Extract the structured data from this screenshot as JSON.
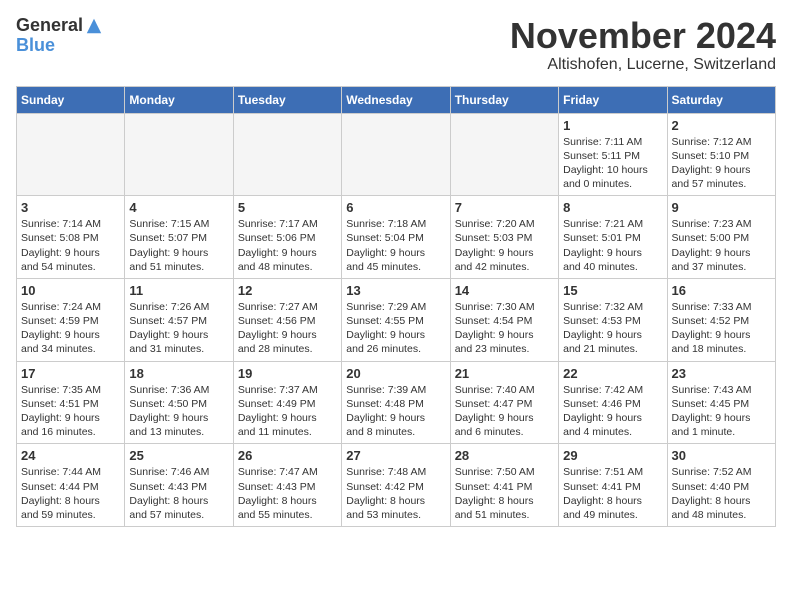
{
  "logo": {
    "general": "General",
    "blue": "Blue"
  },
  "title": "November 2024",
  "location": "Altishofen, Lucerne, Switzerland",
  "days_of_week": [
    "Sunday",
    "Monday",
    "Tuesday",
    "Wednesday",
    "Thursday",
    "Friday",
    "Saturday"
  ],
  "weeks": [
    [
      {
        "day": "",
        "info": ""
      },
      {
        "day": "",
        "info": ""
      },
      {
        "day": "",
        "info": ""
      },
      {
        "day": "",
        "info": ""
      },
      {
        "day": "",
        "info": ""
      },
      {
        "day": "1",
        "info": "Sunrise: 7:11 AM\nSunset: 5:11 PM\nDaylight: 10 hours\nand 0 minutes."
      },
      {
        "day": "2",
        "info": "Sunrise: 7:12 AM\nSunset: 5:10 PM\nDaylight: 9 hours\nand 57 minutes."
      }
    ],
    [
      {
        "day": "3",
        "info": "Sunrise: 7:14 AM\nSunset: 5:08 PM\nDaylight: 9 hours\nand 54 minutes."
      },
      {
        "day": "4",
        "info": "Sunrise: 7:15 AM\nSunset: 5:07 PM\nDaylight: 9 hours\nand 51 minutes."
      },
      {
        "day": "5",
        "info": "Sunrise: 7:17 AM\nSunset: 5:06 PM\nDaylight: 9 hours\nand 48 minutes."
      },
      {
        "day": "6",
        "info": "Sunrise: 7:18 AM\nSunset: 5:04 PM\nDaylight: 9 hours\nand 45 minutes."
      },
      {
        "day": "7",
        "info": "Sunrise: 7:20 AM\nSunset: 5:03 PM\nDaylight: 9 hours\nand 42 minutes."
      },
      {
        "day": "8",
        "info": "Sunrise: 7:21 AM\nSunset: 5:01 PM\nDaylight: 9 hours\nand 40 minutes."
      },
      {
        "day": "9",
        "info": "Sunrise: 7:23 AM\nSunset: 5:00 PM\nDaylight: 9 hours\nand 37 minutes."
      }
    ],
    [
      {
        "day": "10",
        "info": "Sunrise: 7:24 AM\nSunset: 4:59 PM\nDaylight: 9 hours\nand 34 minutes."
      },
      {
        "day": "11",
        "info": "Sunrise: 7:26 AM\nSunset: 4:57 PM\nDaylight: 9 hours\nand 31 minutes."
      },
      {
        "day": "12",
        "info": "Sunrise: 7:27 AM\nSunset: 4:56 PM\nDaylight: 9 hours\nand 28 minutes."
      },
      {
        "day": "13",
        "info": "Sunrise: 7:29 AM\nSunset: 4:55 PM\nDaylight: 9 hours\nand 26 minutes."
      },
      {
        "day": "14",
        "info": "Sunrise: 7:30 AM\nSunset: 4:54 PM\nDaylight: 9 hours\nand 23 minutes."
      },
      {
        "day": "15",
        "info": "Sunrise: 7:32 AM\nSunset: 4:53 PM\nDaylight: 9 hours\nand 21 minutes."
      },
      {
        "day": "16",
        "info": "Sunrise: 7:33 AM\nSunset: 4:52 PM\nDaylight: 9 hours\nand 18 minutes."
      }
    ],
    [
      {
        "day": "17",
        "info": "Sunrise: 7:35 AM\nSunset: 4:51 PM\nDaylight: 9 hours\nand 16 minutes."
      },
      {
        "day": "18",
        "info": "Sunrise: 7:36 AM\nSunset: 4:50 PM\nDaylight: 9 hours\nand 13 minutes."
      },
      {
        "day": "19",
        "info": "Sunrise: 7:37 AM\nSunset: 4:49 PM\nDaylight: 9 hours\nand 11 minutes."
      },
      {
        "day": "20",
        "info": "Sunrise: 7:39 AM\nSunset: 4:48 PM\nDaylight: 9 hours\nand 8 minutes."
      },
      {
        "day": "21",
        "info": "Sunrise: 7:40 AM\nSunset: 4:47 PM\nDaylight: 9 hours\nand 6 minutes."
      },
      {
        "day": "22",
        "info": "Sunrise: 7:42 AM\nSunset: 4:46 PM\nDaylight: 9 hours\nand 4 minutes."
      },
      {
        "day": "23",
        "info": "Sunrise: 7:43 AM\nSunset: 4:45 PM\nDaylight: 9 hours\nand 1 minute."
      }
    ],
    [
      {
        "day": "24",
        "info": "Sunrise: 7:44 AM\nSunset: 4:44 PM\nDaylight: 8 hours\nand 59 minutes."
      },
      {
        "day": "25",
        "info": "Sunrise: 7:46 AM\nSunset: 4:43 PM\nDaylight: 8 hours\nand 57 minutes."
      },
      {
        "day": "26",
        "info": "Sunrise: 7:47 AM\nSunset: 4:43 PM\nDaylight: 8 hours\nand 55 minutes."
      },
      {
        "day": "27",
        "info": "Sunrise: 7:48 AM\nSunset: 4:42 PM\nDaylight: 8 hours\nand 53 minutes."
      },
      {
        "day": "28",
        "info": "Sunrise: 7:50 AM\nSunset: 4:41 PM\nDaylight: 8 hours\nand 51 minutes."
      },
      {
        "day": "29",
        "info": "Sunrise: 7:51 AM\nSunset: 4:41 PM\nDaylight: 8 hours\nand 49 minutes."
      },
      {
        "day": "30",
        "info": "Sunrise: 7:52 AM\nSunset: 4:40 PM\nDaylight: 8 hours\nand 48 minutes."
      }
    ]
  ]
}
